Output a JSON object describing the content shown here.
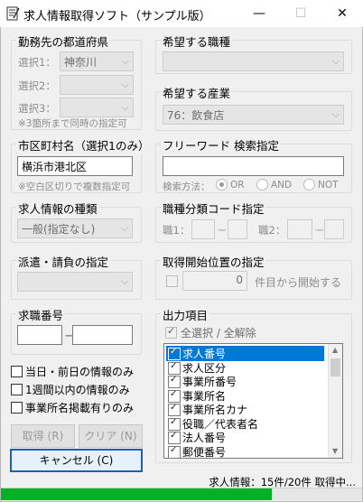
{
  "window": {
    "title": "求人情報取得ソフト（サンプル版）",
    "minimize": "—",
    "maximize": "☐",
    "close": "✕"
  },
  "prefecture": {
    "label": "勤務先の都道府県",
    "select1_label": "選択1：",
    "select1_value": "神奈川",
    "select2_label": "選択2：",
    "select2_value": "",
    "select3_label": "選択3：",
    "select3_value": "",
    "note": "※3箇所まで同時の指定可"
  },
  "occupation": {
    "label": "希望する職種",
    "value": ""
  },
  "industry": {
    "label": "希望する産業",
    "value": "76：飲食店"
  },
  "city": {
    "label": "市区町村名（選択1のみ）",
    "value": "横浜市港北区",
    "note": "※空白区切りで複数指定可"
  },
  "keyword": {
    "label": "フリーワード 検索指定",
    "value": "",
    "method_label": "検索方法：",
    "options": [
      "OR",
      "AND",
      "NOT"
    ],
    "selected": "OR"
  },
  "job_type": {
    "label": "求人情報の種類",
    "value": "一般(指定なし)"
  },
  "category_code": {
    "label": "職種分類コード指定",
    "job1_label": "職1：",
    "job2_label": "職2：",
    "dash": "－"
  },
  "dispatch": {
    "label": "派遣・請負の指定",
    "value": ""
  },
  "start_position": {
    "label": "取得開始位置の指定",
    "value": "0",
    "suffix": "件目から開始する"
  },
  "job_number": {
    "label": "求職番号",
    "dash": "－"
  },
  "filters": [
    "当日・前日の情報のみ",
    "1週間以内の情報のみ",
    "事業所名掲載有りのみ"
  ],
  "output": {
    "label": "出力項目",
    "select_all": "全選択 / 全解除",
    "items": [
      {
        "label": "求人番号",
        "checked": true,
        "selected": true
      },
      {
        "label": "求人区分",
        "checked": true,
        "selected": false
      },
      {
        "label": "事業所番号",
        "checked": true,
        "selected": false
      },
      {
        "label": "事業所名",
        "checked": true,
        "selected": false
      },
      {
        "label": "事業所名カナ",
        "checked": true,
        "selected": false
      },
      {
        "label": "役職／代表者名",
        "checked": true,
        "selected": false
      },
      {
        "label": "法人番号",
        "checked": true,
        "selected": false
      },
      {
        "label": "郵便番号",
        "checked": true,
        "selected": false
      }
    ]
  },
  "buttons": {
    "fetch": "取得 (R)",
    "clear": "クリア (N)",
    "cancel": "キャンセル (C)"
  },
  "status": {
    "text": "求人情報：15件/20件 取得中...",
    "progress": 0.75
  },
  "colors": {
    "accent": "#0078d7",
    "progress": "#06b025"
  }
}
